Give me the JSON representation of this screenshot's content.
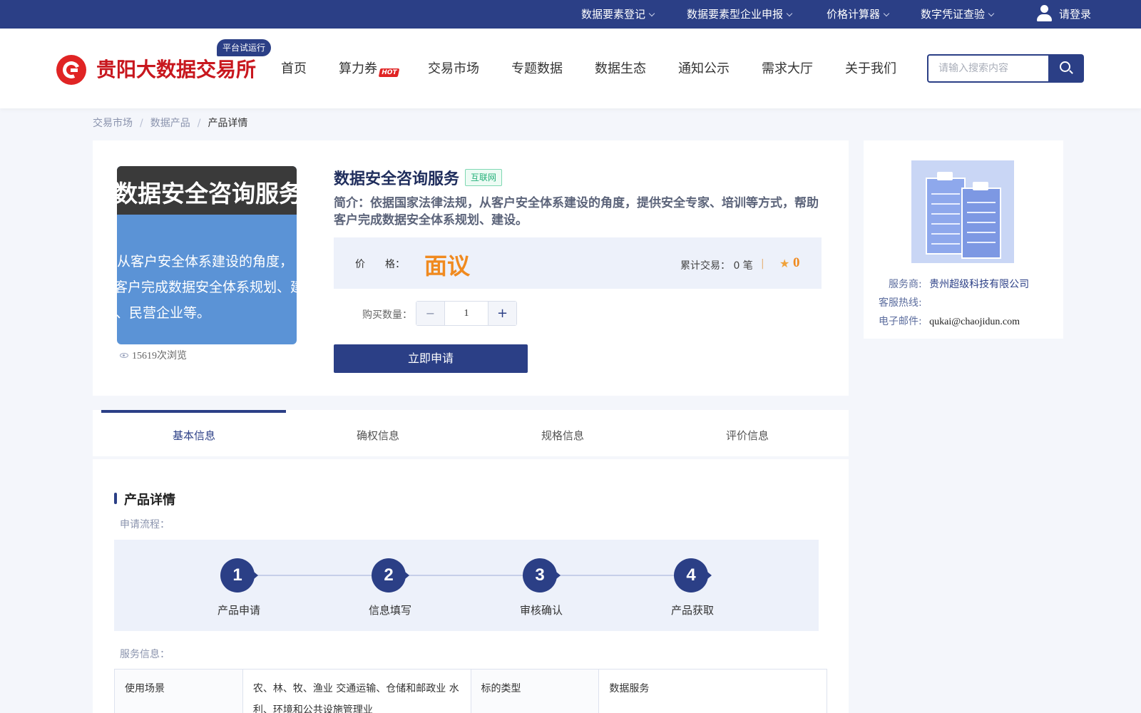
{
  "topbar": {
    "items": [
      "数据要素登记",
      "数据要素型企业申报",
      "价格计算器",
      "数字凭证查验"
    ],
    "login": "请登录"
  },
  "header": {
    "logo_text": "贵阳大数据交易所",
    "trial_badge": "平台试运行",
    "nav": [
      "首页",
      "算力券",
      "交易市场",
      "专题数据",
      "数据生态",
      "通知公示",
      "需求大厅",
      "关于我们"
    ],
    "hot_badge": "HOT",
    "search_placeholder": "请输入搜索内容"
  },
  "breadcrumb": [
    "交易市场",
    "数据产品",
    "产品详情"
  ],
  "product": {
    "cover_title": "数据安全咨询服务",
    "cover_lines": [
      "从客户安全体系建设的角度，",
      "客户完成数据安全体系规划、建",
      "、民营企业等。"
    ],
    "views": "15619次浏览",
    "title": "数据安全咨询服务",
    "tag": "互联网",
    "intro": "简介：依据国家法律法规，从客户安全体系建设的角度，提供安全专家、培训等方式，帮助客户完成数据安全体系规划、建设。",
    "price_label": "价　　格：",
    "price_value": "面议",
    "trade_count": "累计交易： 0 笔",
    "separator": "|",
    "rating": "0",
    "qty_label": "购买数量：",
    "qty_minus": "−",
    "qty_value": "1",
    "qty_plus": "+",
    "apply_button": "立即申请"
  },
  "provider": {
    "vendor_label": "服务商:",
    "vendor_name": "贵州超级科技有限公司",
    "hotline_label": "客服热线:",
    "email_label": "电子邮件:",
    "email": "qukai@chaojidun.com"
  },
  "tabs": [
    "基本信息",
    "确权信息",
    "规格信息",
    "评价信息"
  ],
  "details": {
    "section_title": "产品详情",
    "flow_label": "申请流程：",
    "steps": [
      {
        "num": "1",
        "label": "产品申请"
      },
      {
        "num": "2",
        "label": "信息填写"
      },
      {
        "num": "3",
        "label": "审核确认"
      },
      {
        "num": "4",
        "label": "产品获取"
      }
    ],
    "service_label": "服务信息：",
    "table": {
      "scene_label": "使用场景",
      "scene_value": "农、林、牧、渔业 交通运输、仓储和邮政业 水利、环境和公共设施管理业",
      "type_label": "标的类型",
      "type_value": "数据服务"
    }
  },
  "colors": {
    "brand": "#2b3f86",
    "logo_red": "#c8171e",
    "price_orange": "#f08a1f",
    "tag_green": "#25b07a"
  }
}
